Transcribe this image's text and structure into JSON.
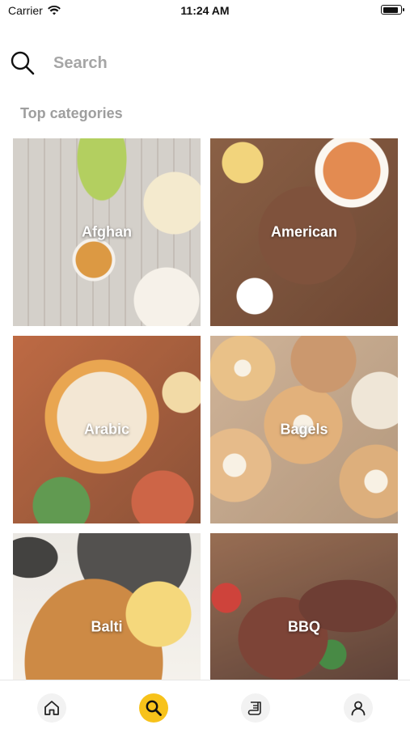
{
  "status_bar": {
    "carrier": "Carrier",
    "time": "11:24 AM",
    "battery_level": 0.9
  },
  "search": {
    "placeholder": "Search",
    "value": ""
  },
  "section_title": "Top categories",
  "categories": [
    {
      "label": "Afghan"
    },
    {
      "label": "American"
    },
    {
      "label": "Arabic"
    },
    {
      "label": "Bagels"
    },
    {
      "label": "Balti"
    },
    {
      "label": "BBQ"
    }
  ],
  "tab_bar": {
    "items": [
      {
        "icon": "home-icon"
      },
      {
        "icon": "search-icon",
        "active": true
      },
      {
        "icon": "orders-icon"
      },
      {
        "icon": "profile-icon"
      }
    ],
    "accent": "#f7c21a"
  }
}
